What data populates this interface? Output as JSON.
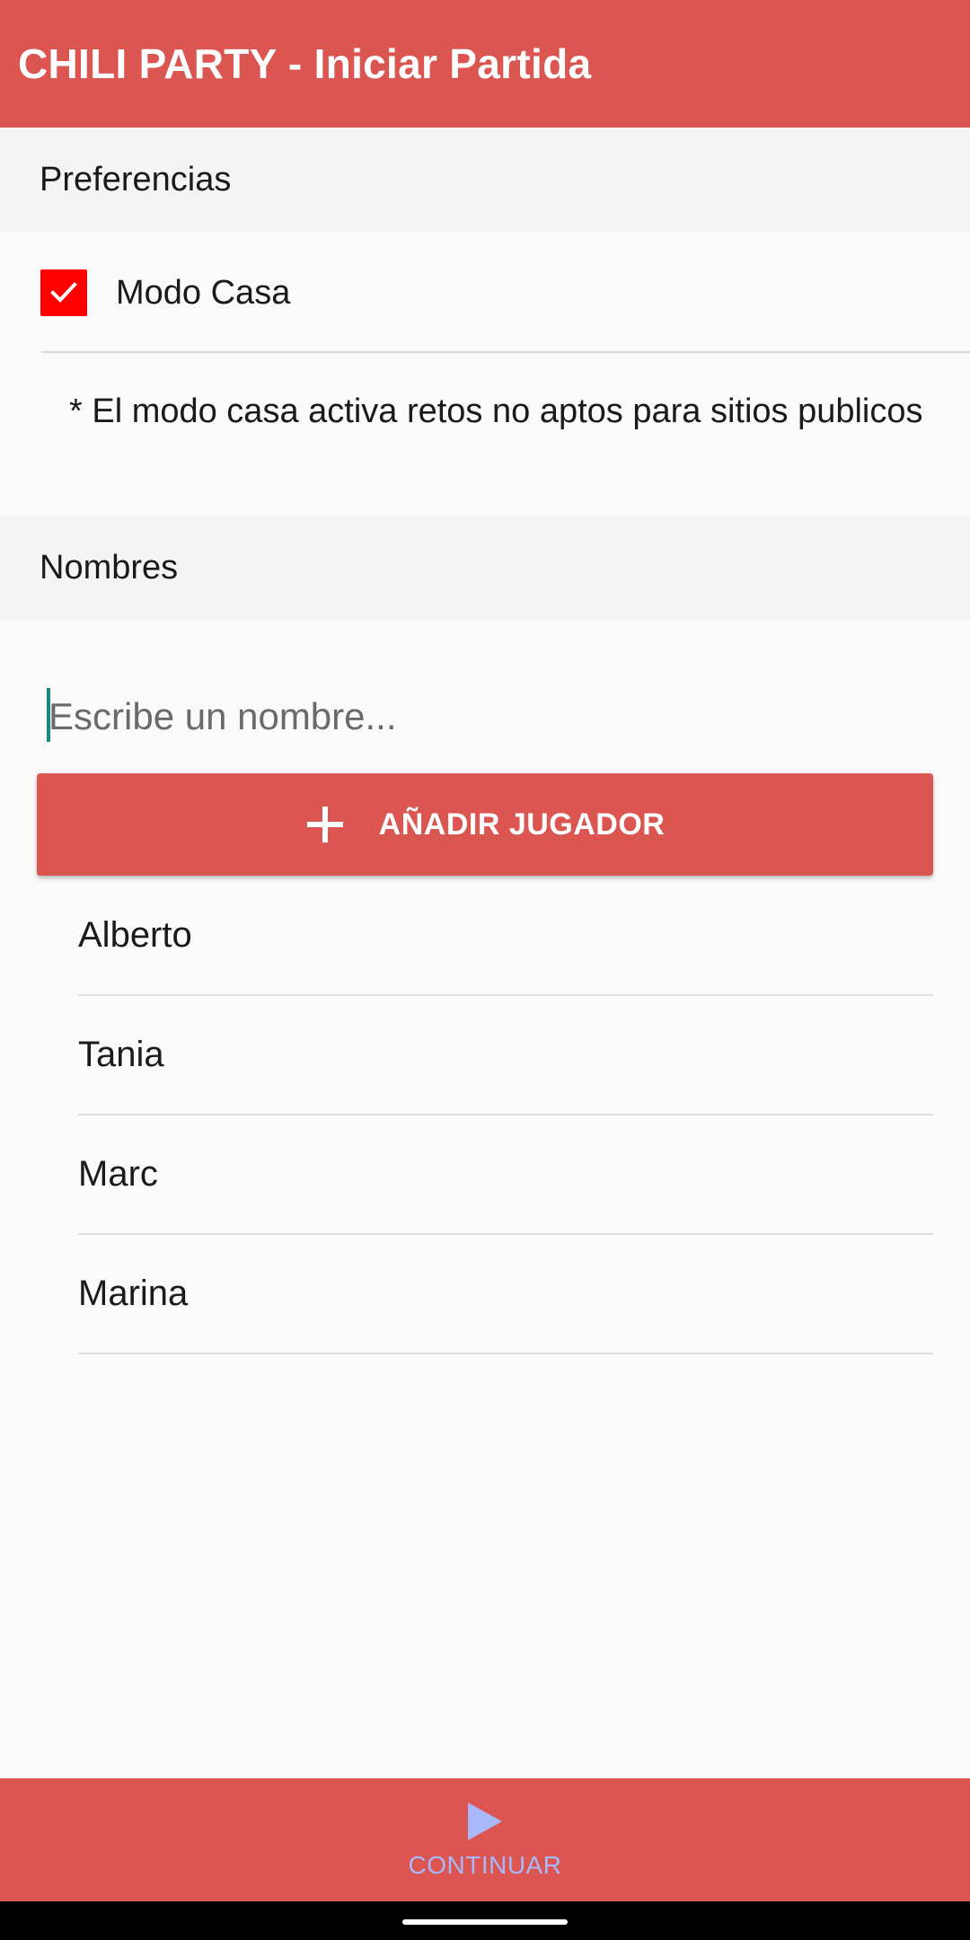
{
  "app_bar": {
    "title": "CHILI PARTY - Iniciar Partida"
  },
  "preferences": {
    "header": "Preferencias",
    "home_mode": {
      "label": "Modo Casa",
      "checked": true
    },
    "note": "* El modo casa activa retos no aptos para sitios publicos"
  },
  "names": {
    "header": "Nombres",
    "input": {
      "value": "",
      "placeholder": "Escribe un nombre..."
    },
    "add_button_label": "AÑADIR JUGADOR",
    "players": [
      "Alberto",
      "Tania",
      "Marc",
      "Marina"
    ]
  },
  "bottom_bar": {
    "continue_label": "CONTINUAR"
  },
  "colors": {
    "primary": "#db5551",
    "checkbox": "#ff0000",
    "continue_accent": "#a8b8f8",
    "cursor": "#178a7c"
  },
  "icons": {
    "checkbox": "checkmark-icon",
    "add": "plus-icon",
    "continue": "play-icon"
  }
}
